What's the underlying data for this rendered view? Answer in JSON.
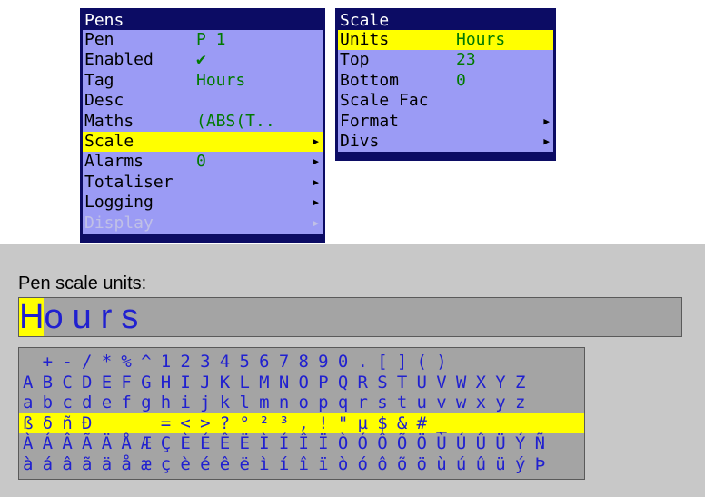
{
  "pens_menu": {
    "title": "Pens",
    "items": [
      {
        "label": "Pen",
        "value": "P 1",
        "arrow": ""
      },
      {
        "label": "Enabled",
        "value": "✔",
        "arrow": ""
      },
      {
        "label": "Tag",
        "value": "Hours",
        "arrow": ""
      },
      {
        "label": "Desc",
        "value": "",
        "arrow": ""
      },
      {
        "label": "Maths",
        "value": "(ABS(T..",
        "arrow": ""
      },
      {
        "label": "Scale",
        "value": "",
        "arrow": "▶"
      },
      {
        "label": "Alarms",
        "value": "0",
        "arrow": "▶"
      },
      {
        "label": "Totaliser",
        "value": "",
        "arrow": "▶"
      },
      {
        "label": "Logging",
        "value": "",
        "arrow": "▶"
      },
      {
        "label": "Display",
        "value": "",
        "arrow": "▶"
      }
    ]
  },
  "scale_menu": {
    "title": "Scale",
    "items": [
      {
        "label": "Units",
        "value": "Hours",
        "arrow": ""
      },
      {
        "label": "Top",
        "value": "23",
        "arrow": ""
      },
      {
        "label": "Bottom",
        "value": "0",
        "arrow": ""
      },
      {
        "label": "Scale Fac",
        "value": "",
        "arrow": ""
      },
      {
        "label": "Format",
        "value": "",
        "arrow": "▶"
      },
      {
        "label": "Divs",
        "value": "",
        "arrow": "▶"
      }
    ]
  },
  "entry": {
    "prompt": "Pen scale units:",
    "cursor_char": "H",
    "rest": "ours"
  },
  "char_grid": {
    "rows": [
      "  + - / * % ^ 1 2 3 4 5 6 7 8 9 0 . [ ] ( )",
      "A B C D E F G H I J K L M N O P Q R S T U V W X Y Z",
      "a b c d e f g h i j k l m n o p q r s t u v w x y z",
      "ß δ ñ Ð       = < > ? ° ² ³ , ! \" µ $ & # _",
      "À Á Â Ã Ä Å Æ Ç È É Ê Ë Ì Í Î Ï Ò Ó Ô Õ Ö Ù Ú Û Ü Ý Ñ",
      "à á â ã ä å æ ç è é ê ë ì í î ï ò ó ô õ ö ù ú û ü ý Þ"
    ]
  }
}
